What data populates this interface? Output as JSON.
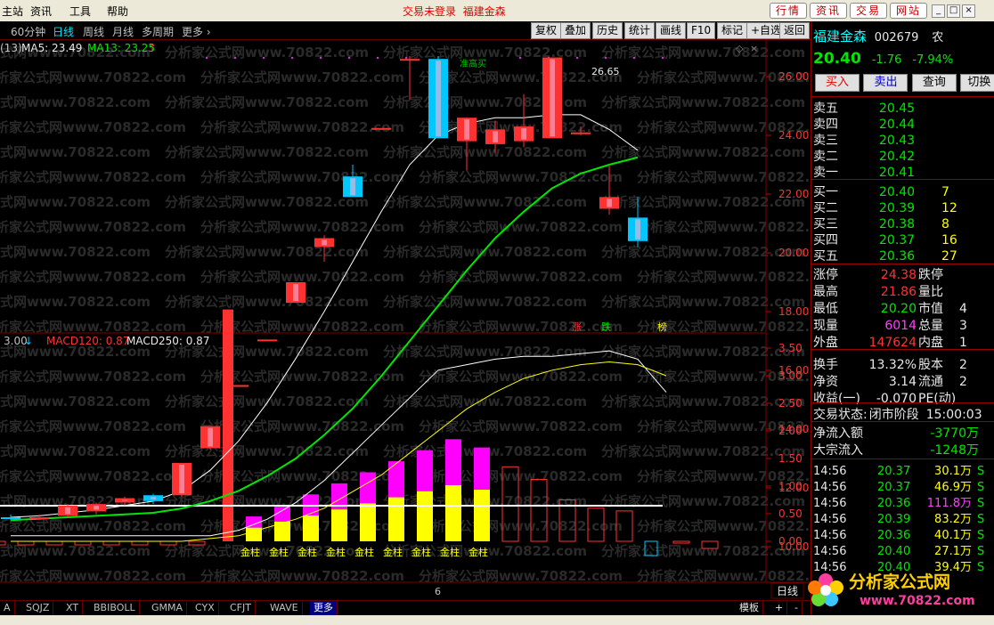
{
  "menubar": {
    "items": [
      "主站",
      "资讯",
      "工具",
      "帮助"
    ],
    "trade_status": "交易未登录",
    "stock_title": "福建金森",
    "right_buttons": [
      "行情",
      "资讯",
      "交易",
      "网站"
    ],
    "window_buttons": [
      "_",
      "□",
      "×"
    ]
  },
  "toolbar": {
    "periods": [
      "60分钟",
      "日线",
      "周线",
      "月线",
      "多周期",
      "更多"
    ],
    "active_period": "日线",
    "buttons": [
      "复权",
      "叠加",
      "历史",
      "统计",
      "画线",
      "F10",
      "标记",
      "+自选",
      "返回"
    ]
  },
  "main_chart": {
    "ma_prefix": "(13)",
    "ma5_label": "MA5: 23.49",
    "ma13_label": "MA13: 23.25",
    "high_label": "26.65",
    "signal_label": "准高买",
    "signal_flags": [
      "涨",
      "跌",
      "榜"
    ],
    "axis_ticks": [
      "26.00",
      "24.00",
      "22.00",
      "20.00",
      "18.00",
      "16.00",
      "14.00",
      "12.00",
      "10.00"
    ]
  },
  "macd_chart": {
    "prefix": "3.00",
    "macd120_label": "MACD120: 0.87",
    "macd250_label": "MACD250: 0.87",
    "bar_label": "金柱",
    "axis_ticks": [
      "3.50",
      "3.00",
      "2.50",
      "2.00",
      "1.50",
      "1.00",
      "0.50",
      "0.00"
    ],
    "x_marker": "6",
    "period_label": "日线"
  },
  "watermark": "分析家公式网www.70822.com",
  "quote": {
    "name": "福建金森",
    "code": "002679",
    "sector_abbr": "农",
    "price": "20.40",
    "change": "-1.76",
    "change_pct": "-7.94%",
    "buttons": [
      "买入",
      "卖出",
      "查询",
      "切换"
    ],
    "asks": [
      {
        "label": "卖五",
        "price": "20.45",
        "vol": ""
      },
      {
        "label": "卖四",
        "price": "20.44",
        "vol": ""
      },
      {
        "label": "卖三",
        "price": "20.43",
        "vol": ""
      },
      {
        "label": "卖二",
        "price": "20.42",
        "vol": ""
      },
      {
        "label": "卖一",
        "price": "20.41",
        "vol": ""
      }
    ],
    "bids": [
      {
        "label": "买一",
        "price": "20.40",
        "vol": "7"
      },
      {
        "label": "买二",
        "price": "20.39",
        "vol": "12"
      },
      {
        "label": "买三",
        "price": "20.38",
        "vol": "8"
      },
      {
        "label": "买四",
        "price": "20.37",
        "vol": "16"
      },
      {
        "label": "买五",
        "price": "20.36",
        "vol": "27"
      }
    ],
    "stats": [
      {
        "l1": "涨停",
        "v1": "24.38",
        "l2": "跌停",
        "v2": ""
      },
      {
        "l1": "最高",
        "v1": "21.86",
        "l2": "量比",
        "v2": ""
      },
      {
        "l1": "最低",
        "v1": "20.20",
        "l2": "市值",
        "v2": "4"
      },
      {
        "l1": "现量",
        "v1": "6014",
        "l2": "总量",
        "v2": "3"
      },
      {
        "l1": "外盘",
        "v1": "147624",
        "l2": "内盘",
        "v2": "1"
      }
    ],
    "fin": [
      {
        "l1": "换手",
        "v1": "13.32%",
        "l2": "股本",
        "v2": "2"
      },
      {
        "l1": "净资",
        "v1": "3.14",
        "l2": "流通",
        "v2": "2"
      },
      {
        "l1": "收益(一)",
        "v1": "-0.070",
        "l2": "PE(动)",
        "v2": ""
      }
    ],
    "trade_state_label": "交易状态:",
    "trade_state": "闭市阶段",
    "trade_time": "15:00:03",
    "flows": [
      {
        "label": "净流入额",
        "value": "-3770万"
      },
      {
        "label": "大宗流入",
        "value": "-1248万"
      }
    ],
    "ticks": [
      {
        "time": "14:56",
        "price": "20.37",
        "vol": "30.1万",
        "dir": "S"
      },
      {
        "time": "14:56",
        "price": "20.37",
        "vol": "46.9万",
        "dir": "S"
      },
      {
        "time": "14:56",
        "price": "20.36",
        "vol": "111.8万",
        "dir": "S"
      },
      {
        "time": "14:56",
        "price": "20.39",
        "vol": "83.2万",
        "dir": "S"
      },
      {
        "time": "14:56",
        "price": "20.36",
        "vol": "40.1万",
        "dir": "S"
      },
      {
        "time": "14:56",
        "price": "20.40",
        "vol": "27.1万",
        "dir": "S"
      },
      {
        "time": "14:56",
        "price": "20.40",
        "vol": "39.4万",
        "dir": "S"
      }
    ]
  },
  "bottom_tabs": [
    "A",
    "SQJZ",
    "XT",
    "BBIBOLL",
    "GMMA",
    "CYX",
    "CFJT",
    "WAVE",
    "更多"
  ],
  "bottom_right": [
    "模板",
    "+",
    "-"
  ],
  "logo": {
    "line1": "分析家公式网",
    "line2": "www.70822.com"
  },
  "colors": {
    "up": "#ff3232",
    "down": "#00c8ff",
    "ma5": "#ffffff",
    "ma13": "#00e600",
    "macd_fast": "#ffffff",
    "macd_slow": "#ffff00",
    "bar_top": "#ff00ff",
    "bar_bottom": "#ffff00"
  },
  "candles": [
    {
      "o": 10.95,
      "h": 11.1,
      "l": 10.9,
      "c": 11.0,
      "dir": "down"
    },
    {
      "o": 10.95,
      "h": 11.1,
      "l": 10.9,
      "c": 11.0,
      "dir": "up"
    },
    {
      "o": 11.05,
      "h": 11.45,
      "l": 11.0,
      "c": 11.4,
      "dir": "up"
    },
    {
      "o": 11.2,
      "h": 11.5,
      "l": 11.1,
      "c": 11.45,
      "dir": "up"
    },
    {
      "o": 11.5,
      "h": 11.7,
      "l": 11.4,
      "c": 11.65,
      "dir": "up"
    },
    {
      "o": 11.55,
      "h": 11.8,
      "l": 11.45,
      "c": 11.75,
      "dir": "down"
    },
    {
      "o": 11.75,
      "h": 12.85,
      "l": 11.7,
      "c": 12.85,
      "dir": "up"
    },
    {
      "o": 13.35,
      "h": 14.1,
      "l": 13.3,
      "c": 14.1,
      "dir": "up"
    },
    {
      "o": 15.5,
      "h": 15.5,
      "l": 15.5,
      "c": 15.5,
      "dir": "up"
    },
    {
      "o": 17.05,
      "h": 17.05,
      "l": 17.05,
      "c": 17.05,
      "dir": "up"
    },
    {
      "o": 18.3,
      "h": 19.0,
      "l": 18.3,
      "c": 19.0,
      "dir": "up"
    },
    {
      "o": 20.2,
      "h": 20.6,
      "l": 19.7,
      "c": 20.5,
      "dir": "up"
    },
    {
      "o": 22.6,
      "h": 23.0,
      "l": 22.2,
      "c": 21.9,
      "dir": "down"
    },
    {
      "o": 24.25,
      "h": 24.25,
      "l": 24.25,
      "c": 24.25,
      "dir": "up"
    },
    {
      "o": 26.6,
      "h": 26.7,
      "l": 25.2,
      "c": 26.6,
      "dir": "up"
    },
    {
      "o": 26.6,
      "h": 26.7,
      "l": 23.9,
      "c": 23.9,
      "dir": "down"
    },
    {
      "o": 23.8,
      "h": 24.6,
      "l": 22.8,
      "c": 24.6,
      "dir": "up"
    },
    {
      "o": 23.7,
      "h": 24.5,
      "l": 23.4,
      "c": 24.2,
      "dir": "up"
    },
    {
      "o": 23.8,
      "h": 25.4,
      "l": 23.6,
      "c": 24.3,
      "dir": "up"
    },
    {
      "o": 23.9,
      "h": 26.65,
      "l": 23.9,
      "c": 26.65,
      "dir": "up"
    },
    {
      "o": 24.1,
      "h": 24.3,
      "l": 24.0,
      "c": 24.1,
      "dir": "up"
    },
    {
      "o": 21.9,
      "h": 23.0,
      "l": 21.3,
      "c": 21.5,
      "dir": "up"
    },
    {
      "o": 21.2,
      "h": 21.9,
      "l": 20.2,
      "c": 20.4,
      "dir": "down"
    }
  ],
  "ma5": [
    11.0,
    11.05,
    11.15,
    11.25,
    11.4,
    11.55,
    11.9,
    12.6,
    13.6,
    14.9,
    16.4,
    18.0,
    19.7,
    21.4,
    23.0,
    24.0,
    24.4,
    24.6,
    24.6,
    24.7,
    24.7,
    24.2,
    23.49
  ],
  "ma13": [
    10.9,
    10.95,
    11.0,
    11.05,
    11.1,
    11.15,
    11.3,
    11.55,
    11.9,
    12.4,
    13.0,
    13.8,
    14.7,
    15.8,
    17.0,
    18.2,
    19.4,
    20.5,
    21.4,
    22.2,
    22.7,
    23.0,
    23.25
  ],
  "macd_bars": [
    -0.1,
    -0.1,
    -0.1,
    -0.1,
    -0.1,
    -0.1,
    -0.1,
    -0.1,
    4.2,
    0.45,
    0.65,
    0.85,
    1.05,
    1.25,
    1.45,
    1.65,
    1.85,
    1.7,
    1.35,
    1.12,
    0.75,
    0.6,
    0.55,
    0.2,
    -0.05,
    -0.2
  ],
  "macd_fast": [
    0.1,
    0.1,
    0.1,
    0.1,
    0.1,
    0.1,
    0.1,
    0.1,
    0.2,
    0.4,
    0.7,
    1.1,
    1.6,
    2.1,
    2.6,
    3.1,
    3.2,
    3.3,
    3.35,
    3.35,
    3.4,
    3.45,
    3.3,
    2.7
  ],
  "macd_slow": [
    0.0,
    0.0,
    0.0,
    0.0,
    0.0,
    0.0,
    0.0,
    0.05,
    0.1,
    0.25,
    0.4,
    0.6,
    0.9,
    1.2,
    1.6,
    2.0,
    2.4,
    2.7,
    2.95,
    3.1,
    3.2,
    3.25,
    3.2,
    3.0
  ]
}
